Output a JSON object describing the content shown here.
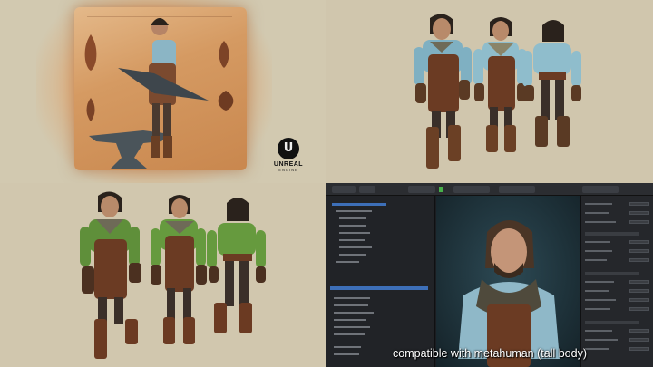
{
  "logo": {
    "word": "UNREAL",
    "sub": "ENGINE",
    "glyph": "U"
  },
  "caption": "compatible with metahuman (tall body)",
  "colors": {
    "background": "#cdc3ab",
    "parchment": "#d59a62",
    "shirt_blue": "#7fb0c2",
    "shirt_green": "#5f8f3a",
    "apron_leather": "#6b3b23",
    "editor_bg": "#1b1d21",
    "viewport": "#2d4a55",
    "selection": "#3d6fb8",
    "caption_text": "#ffffff"
  },
  "icons": [
    "unreal-engine-logo",
    "play-icon"
  ]
}
